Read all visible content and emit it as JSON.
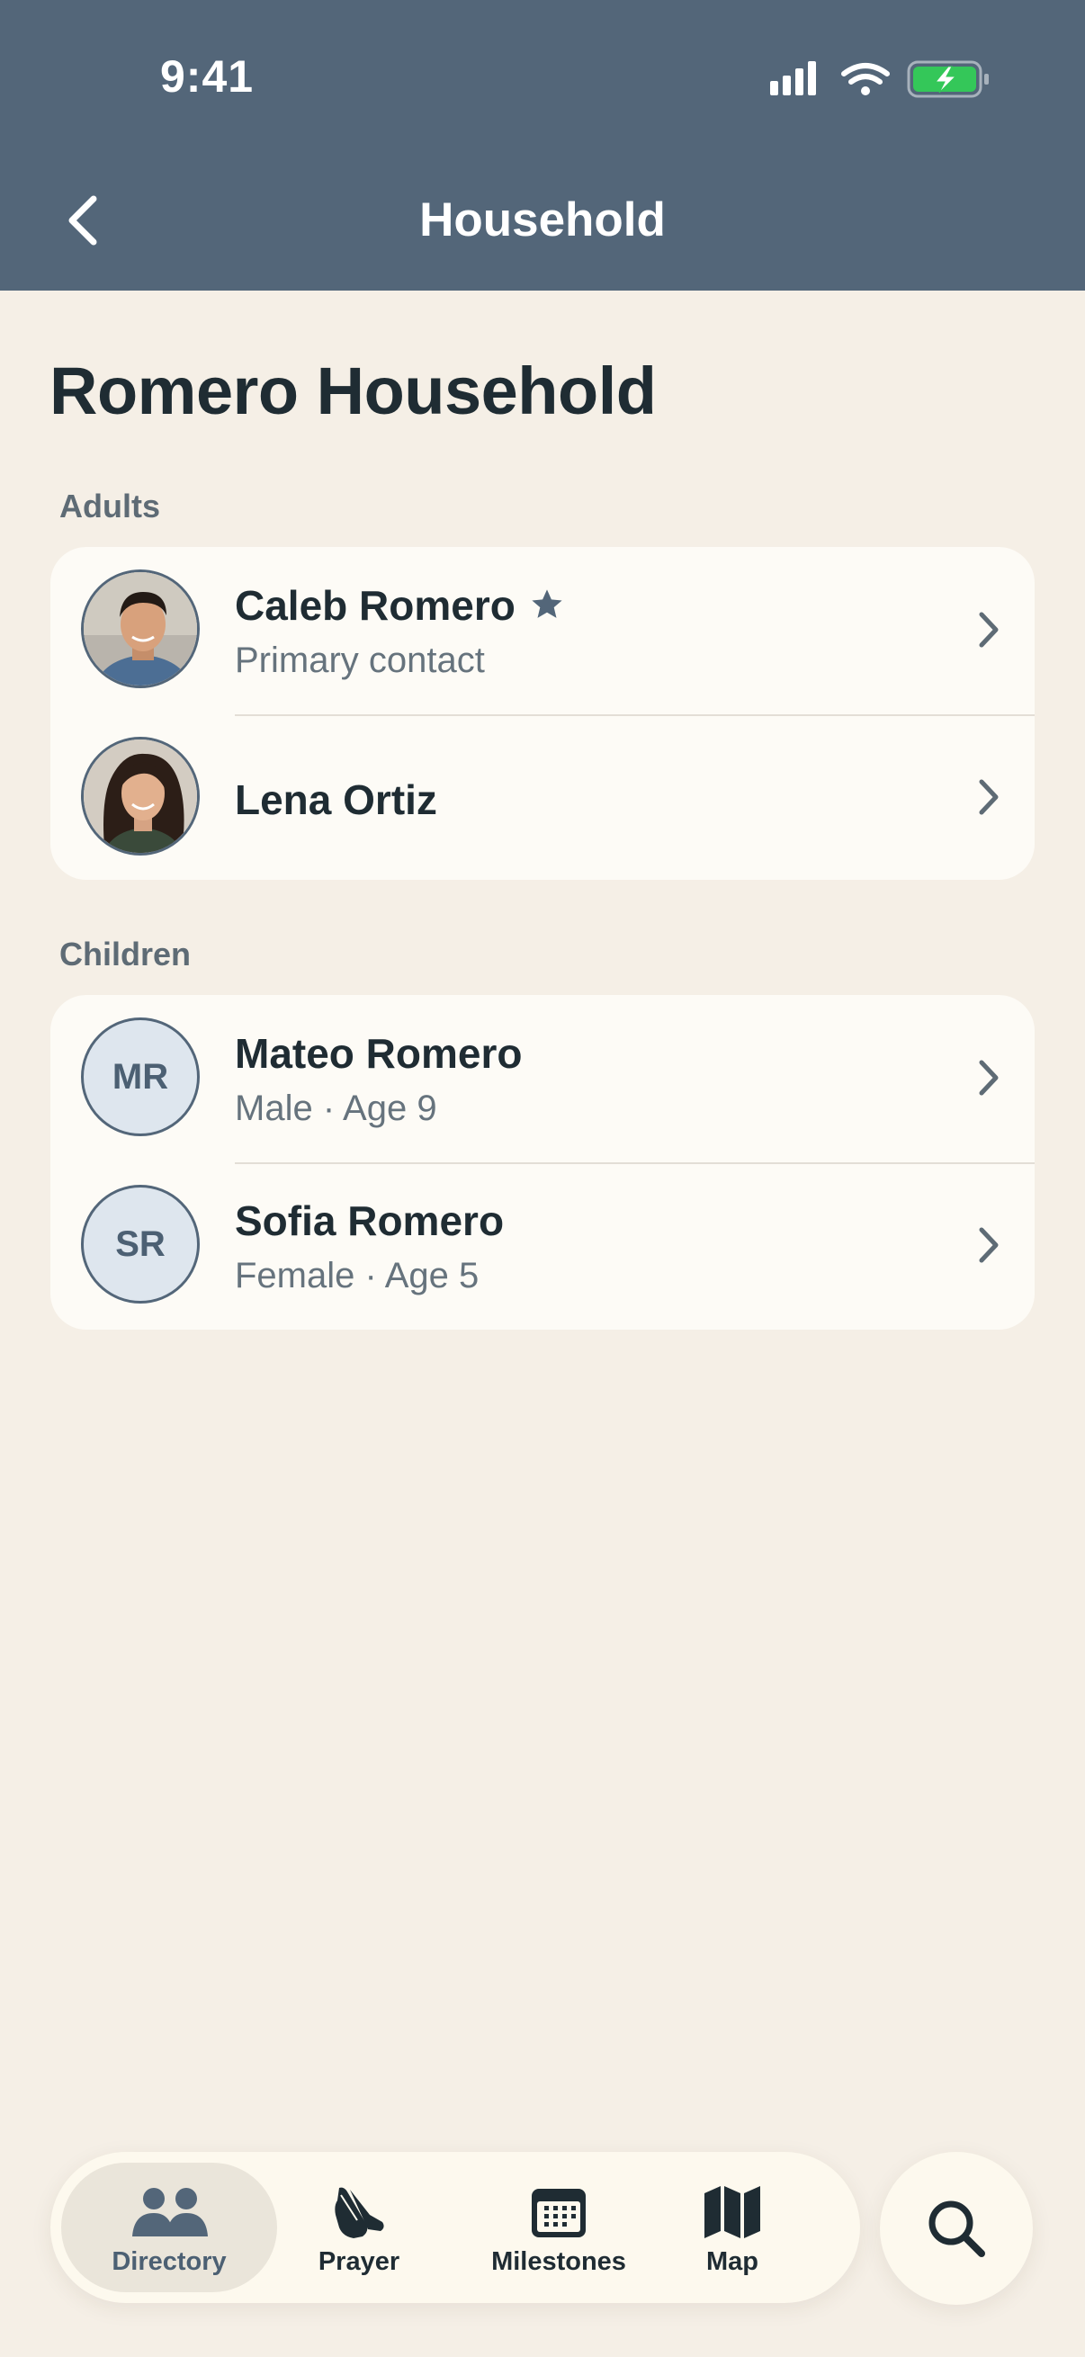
{
  "status_bar": {
    "time": "9:41"
  },
  "nav": {
    "title": "Household",
    "back_icon": "chevron-left-icon"
  },
  "page": {
    "title": "Romero Household"
  },
  "sections": {
    "adults": {
      "label": "Adults",
      "members": [
        {
          "name": "Caleb Romero",
          "subtitle": "Primary contact",
          "primary": true,
          "avatar": "photo"
        },
        {
          "name": "Lena Ortiz",
          "subtitle": "",
          "avatar": "photo"
        }
      ]
    },
    "children": {
      "label": "Children",
      "members": [
        {
          "name": "Mateo Romero",
          "initials": "MR",
          "subtitle": "Male · Age 9"
        },
        {
          "name": "Sofia Romero",
          "initials": "SR",
          "subtitle": "Female · Age 5"
        }
      ]
    }
  },
  "tabbar": {
    "tabs": [
      {
        "label": "Directory",
        "icon": "people-icon",
        "active": true
      },
      {
        "label": "Prayer",
        "icon": "praying-hands-icon",
        "active": false
      },
      {
        "label": "Milestones",
        "icon": "calendar-icon",
        "active": false
      },
      {
        "label": "Map",
        "icon": "map-icon",
        "active": false
      }
    ],
    "search_icon": "search-icon"
  },
  "colors": {
    "header": "#536679",
    "background": "#F5EFE6",
    "card": "#FDFBF6",
    "accent": "#536679",
    "battery": "#34C759"
  }
}
